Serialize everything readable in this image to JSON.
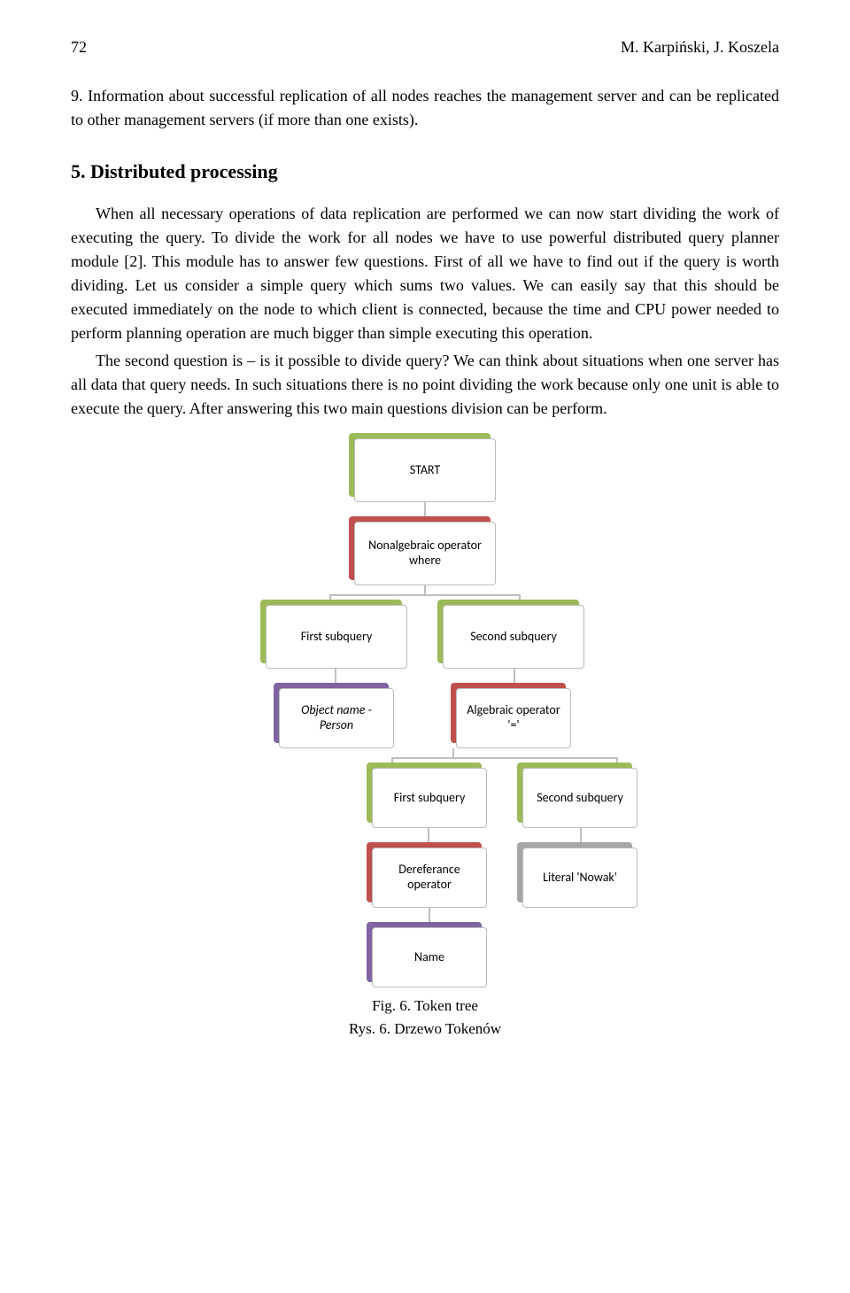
{
  "page_number": "72",
  "authors": "M. Karpiński, J. Koszela",
  "list_item": {
    "num": "9.",
    "text": "Information about successful replication of all nodes reaches the management server and can be replicated to other management servers (if more than one exists)."
  },
  "section": {
    "num": "5.",
    "title": "Distributed processing"
  },
  "para1": "When all necessary operations of data replication are performed we can now start dividing the work of executing the query. To divide the work for all nodes we have to use powerful distributed query planner module [2]. This module has to answer few questions. First of all we have to find out if the query is worth dividing. Let us consider a simple query which sums two values. We can easily say that this should be executed immediately on the node to which client is connected, because the time and CPU power needed to perform planning operation are much bigger than simple executing this operation.",
  "para2": "The second question is – is it possible to divide query? We can think about situations when one server has all data that query needs. In such situations there is no point dividing the work because only one unit is able to execute the query. After answering this two main questions division can be perform.",
  "diagram": {
    "n_start": "START",
    "n_where": "Nonalgebraic operator where",
    "n_first1": "First subquery",
    "n_second1": "Second subquery",
    "n_obj": "Object name - Person",
    "n_alg": "Algebraic operator '='",
    "n_first2": "First subquery",
    "n_second2": "Second subquery",
    "n_deref": "Dereferance operator",
    "n_lit": "Literal 'Nowak'",
    "n_name": "Name"
  },
  "caption_en": "Fig. 6.  Token tree",
  "caption_pl": "Rys. 6.  Drzewo Tokenów"
}
